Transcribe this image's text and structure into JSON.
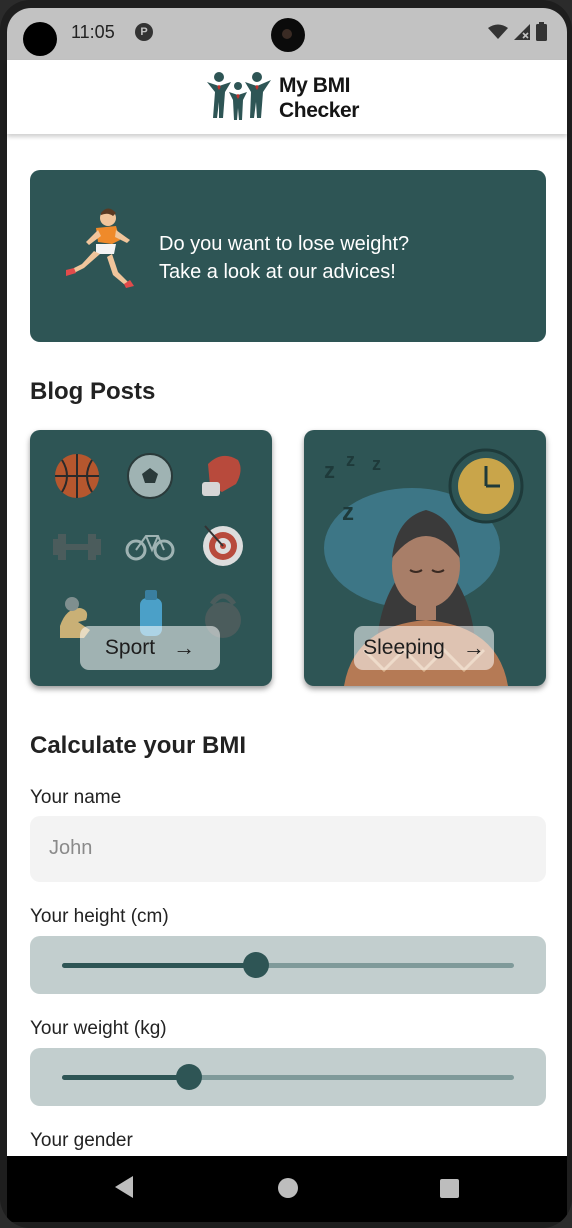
{
  "status_bar": {
    "time": "11:05",
    "app_indicator": "P",
    "icons": [
      "wifi-icon",
      "signal-icon",
      "battery-icon"
    ]
  },
  "app_bar": {
    "title_line1": "My BMI",
    "title_line2": "Checker",
    "logo_icon": "family-logo-icon"
  },
  "banner": {
    "line1": "Do you want to lose weight?",
    "line2": "Take a look at our advices!",
    "icon": "runner-icon"
  },
  "blog": {
    "title": "Blog Posts",
    "cards": [
      {
        "label": "Sport",
        "icon": "sport-icon"
      },
      {
        "label": "Sleeping",
        "icon": "sleeping-icon"
      }
    ]
  },
  "bmi_form": {
    "title": "Calculate your BMI",
    "name_label": "Your name",
    "name_placeholder": "John",
    "height_label": "Your height (cm)",
    "height_value": 0.43,
    "weight_label": "Your weight (kg)",
    "weight_value": 0.28,
    "gender_label": "Your gender"
  },
  "nav_bar": {
    "icons": [
      "back-icon",
      "home-icon",
      "recents-icon"
    ]
  },
  "colors": {
    "primary": "#2e5555",
    "slider_bg": "#c2cece",
    "input_bg": "#f3f3f3"
  }
}
